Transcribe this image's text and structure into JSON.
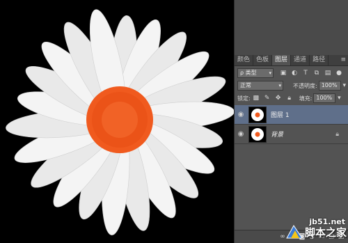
{
  "panel_tabs": [
    "颜色",
    "色板",
    "图层",
    "通道",
    "路径"
  ],
  "filter": {
    "kind_label": "ρ 类型"
  },
  "blend": {
    "mode": "正常",
    "opacity_label": "不透明度:",
    "opacity_value": "100%"
  },
  "lock": {
    "label": "锁定:",
    "fill_label": "填充:",
    "fill_value": "100%"
  },
  "layers": [
    {
      "name": "图层 1",
      "selected": true
    },
    {
      "name": "背景",
      "selected": false
    }
  ],
  "footer_icons": [
    "link-icon",
    "fx-icon",
    "mask-icon",
    "adjustment-icon",
    "folder-icon",
    "new-layer-icon",
    "trash-icon"
  ],
  "watermark": {
    "site": "jb51.net",
    "brand": "脚本之家"
  },
  "colors": {
    "panel_bg": "#535353",
    "selected_layer": "#5f6f8a",
    "flower_center": "#f05a1e"
  }
}
